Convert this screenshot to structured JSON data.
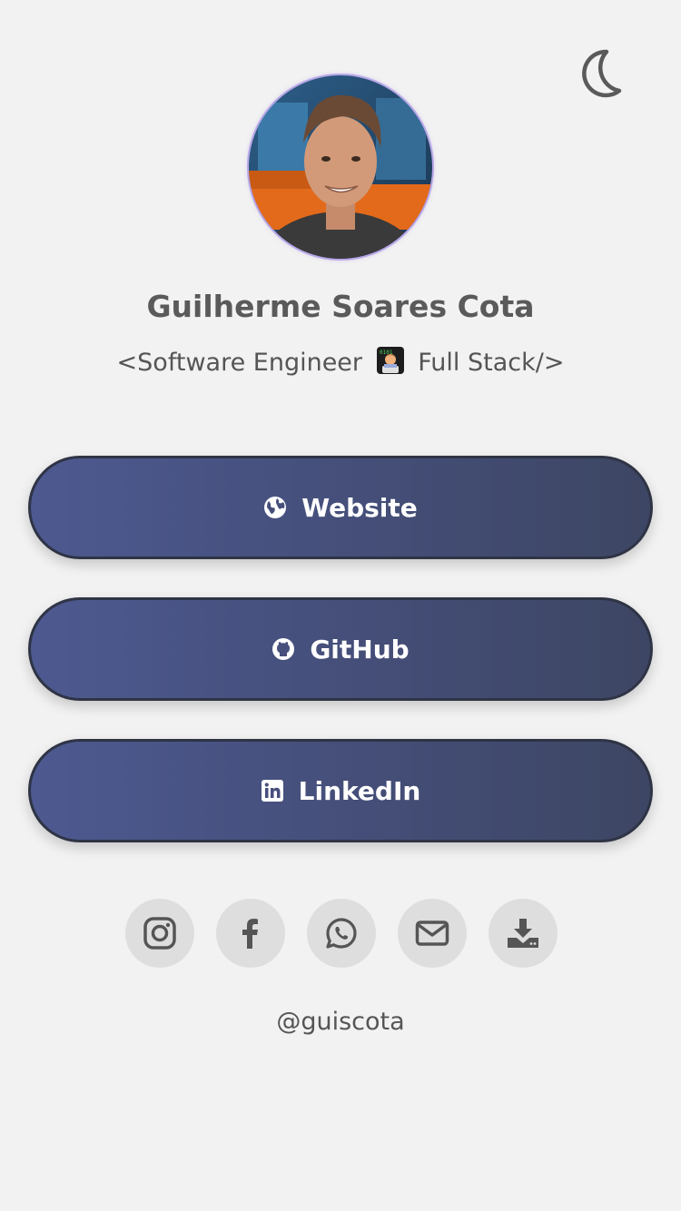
{
  "profile": {
    "name": "Guilherme Soares Cota",
    "tagline_prefix": "<Software Engineer",
    "tagline_suffix": "Full Stack/>",
    "tagline_emoji": "technologist-emoji",
    "avatar": "profile-photo"
  },
  "theme_toggle": {
    "icon": "moon-icon"
  },
  "links": [
    {
      "label": "Website",
      "icon": "globe-icon"
    },
    {
      "label": "GitHub",
      "icon": "github-icon"
    },
    {
      "label": "LinkedIn",
      "icon": "linkedin-icon"
    }
  ],
  "social": [
    {
      "icon": "instagram-icon"
    },
    {
      "icon": "facebook-icon"
    },
    {
      "icon": "whatsapp-icon"
    },
    {
      "icon": "envelope-icon"
    },
    {
      "icon": "download-icon"
    }
  ],
  "footer": {
    "handle": "@guiscota"
  },
  "colors": {
    "background": "#f2f2f2",
    "button_gradient_start": "#4d5990",
    "button_gradient_end": "#3d4663",
    "button_border": "#2f3445",
    "social_bg": "#dedede",
    "text": "#555555"
  }
}
